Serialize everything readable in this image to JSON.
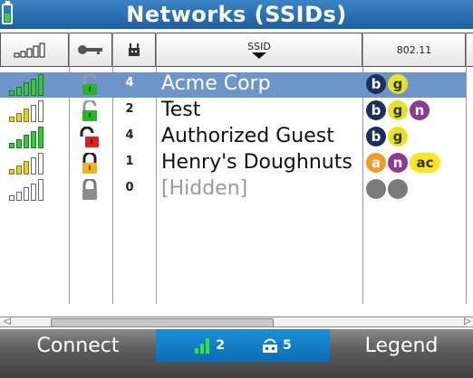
{
  "title": "Networks (SSIDs)",
  "columns": {
    "ssid": "SSID",
    "std": "802.11"
  },
  "rows": [
    {
      "signal": 5,
      "lock": "open-green",
      "count": "4",
      "ssid": "Acme Corp",
      "standards": [
        "b",
        "g"
      ],
      "selected": true
    },
    {
      "signal": 3,
      "lock": "open-green",
      "count": "2",
      "ssid": "Test",
      "standards": [
        "b",
        "g",
        "n"
      ],
      "selected": false
    },
    {
      "signal": 5,
      "lock": "open-red",
      "count": "4",
      "ssid": "Authorized Guest",
      "standards": [
        "b",
        "g"
      ],
      "selected": false
    },
    {
      "signal": 3,
      "lock": "closed-yellow",
      "count": "1",
      "ssid": "Henry's Doughnuts",
      "standards": [
        "a",
        "n",
        "ac"
      ],
      "selected": false
    },
    {
      "signal": 0,
      "lock": "closed-gray",
      "count": "0",
      "ssid": "[Hidden]",
      "standards": [
        "x",
        "x"
      ],
      "selected": false
    }
  ],
  "bottom": {
    "connect": "Connect",
    "signal_count": "2",
    "ap_count": "5",
    "legend": "Legend"
  },
  "icons": [
    "battery-icon",
    "signal-bars-icon",
    "key-icon",
    "access-point-icon",
    "sort-down-icon",
    "lock-icon"
  ]
}
